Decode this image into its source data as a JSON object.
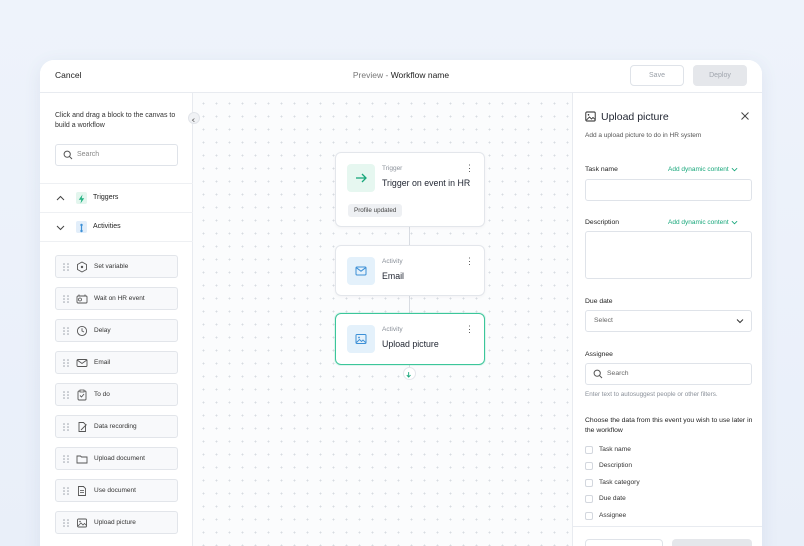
{
  "colors": {
    "accent": "#18a77b",
    "selected_border": "#3cc69a",
    "trigger_bg": "#e6f7f0",
    "activity_bg": "#e4f1fb",
    "activity_icon": "#3b8fd6"
  },
  "header": {
    "cancel_label": "Cancel",
    "title_prefix": "Preview - ",
    "title_name": "Workflow name",
    "save_label": "Save",
    "deploy_label": "Deploy"
  },
  "sidebar": {
    "hint": "Click and drag a block to the canvas to build a workflow",
    "search_placeholder": "Search",
    "sections": [
      {
        "label": "Triggers",
        "icon": "lightning-icon",
        "state": "collapsed"
      },
      {
        "label": "Activities",
        "icon": "activity-icon",
        "state": "expanded"
      }
    ],
    "blocks": [
      {
        "label": "Set variable",
        "icon": "variable-icon"
      },
      {
        "label": "Wait on HR event",
        "icon": "wait-event-icon"
      },
      {
        "label": "Delay",
        "icon": "clock-icon"
      },
      {
        "label": "Email",
        "icon": "mail-icon"
      },
      {
        "label": "To do",
        "icon": "checklist-icon"
      },
      {
        "label": "Data recording",
        "icon": "edit-doc-icon"
      },
      {
        "label": "Upload document",
        "icon": "folder-icon"
      },
      {
        "label": "Use document",
        "icon": "document-icon"
      },
      {
        "label": "Upload picture",
        "icon": "image-icon"
      }
    ]
  },
  "canvas": {
    "nodes": [
      {
        "kind": "Trigger",
        "name": "Trigger on event in HR",
        "chip": "Profile updated",
        "icon": "arrow-right-icon"
      },
      {
        "kind": "Activity",
        "name": "Email",
        "icon": "mail-icon"
      },
      {
        "kind": "Activity",
        "name": "Upload picture",
        "icon": "image-icon",
        "selected": true
      }
    ]
  },
  "panel": {
    "title": "Upload picture",
    "description": "Add a upload picture to do in HR system",
    "task_name_label": "Task name",
    "dynamic_label": "Add dynamic content",
    "description_label": "Description",
    "due_date_label": "Due date",
    "due_date_placeholder": "Select",
    "assignee_label": "Assignee",
    "assignee_placeholder": "Search",
    "assignee_helper": "Enter text to autosuggest people or other filters.",
    "choose_text": "Choose the data from this event you wish to use later in the workflow",
    "checkboxes": [
      "Task name",
      "Description",
      "Task category",
      "Due date",
      "Assignee"
    ]
  }
}
